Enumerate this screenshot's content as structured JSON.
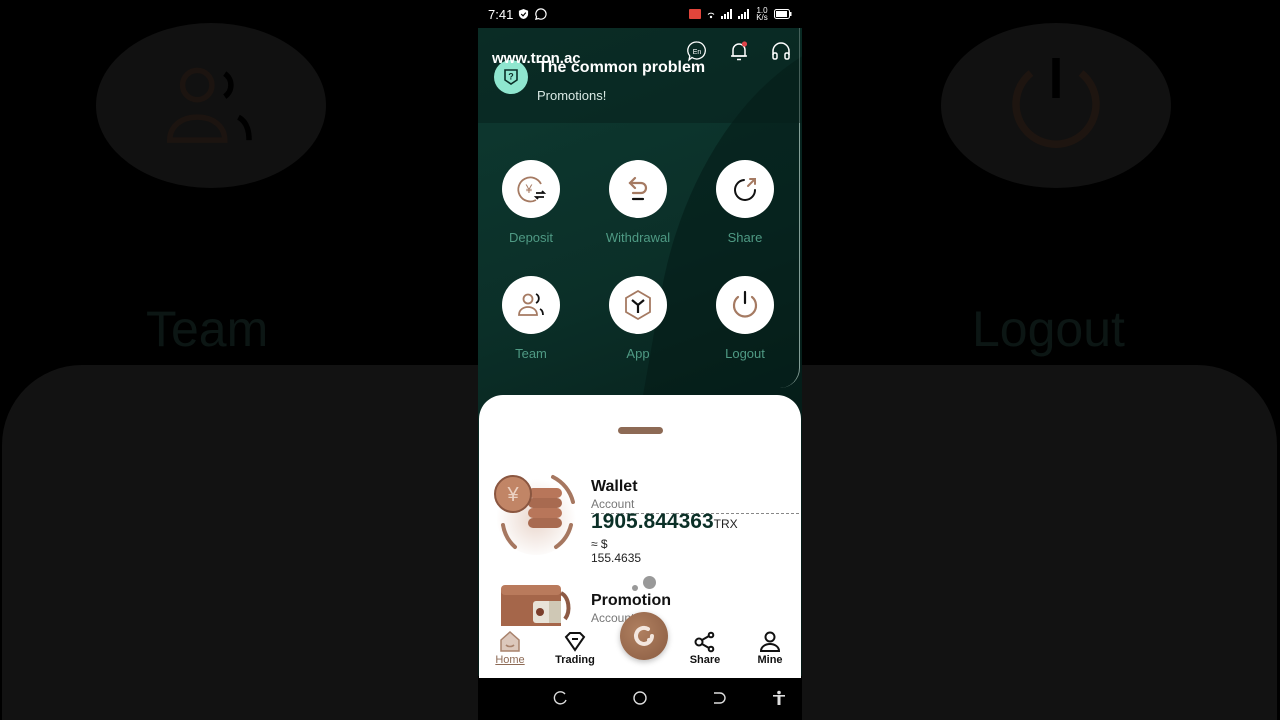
{
  "status_bar": {
    "time": "7:41",
    "left_icons": [
      "shield-check-icon",
      "whatsapp-icon"
    ],
    "right_icons": [
      "cast-icon",
      "wifi-icon",
      "signal-icon",
      "signal-icon"
    ],
    "net_speed": "1.0 K/s",
    "battery_icon": "battery-icon"
  },
  "header": {
    "site_url": "www.tron.ac",
    "icons": [
      "language-icon",
      "bell-icon",
      "headset-icon"
    ],
    "language_label": "En",
    "notification_dot_color": "#e0434a"
  },
  "notice": {
    "title": "The common problem",
    "subtitle": "Promotions!",
    "icon": "question-shield-icon"
  },
  "actions": [
    {
      "label": "Deposit",
      "icon": "deposit-icon"
    },
    {
      "label": "Withdrawal",
      "icon": "withdrawal-icon"
    },
    {
      "label": "Share",
      "icon": "share-icon"
    },
    {
      "label": "Team",
      "icon": "team-icon"
    },
    {
      "label": "App",
      "icon": "app-icon"
    },
    {
      "label": "Logout",
      "icon": "logout-icon"
    }
  ],
  "accounts": [
    {
      "title": "Wallet",
      "subtitle": "Account",
      "amount": "1905.844363",
      "unit": "TRX",
      "usd": "≈ $ 155.4635",
      "icon": "coins-icon"
    },
    {
      "title": "Promotion",
      "subtitle": "Account",
      "icon": "wallet-icon"
    }
  ],
  "bottom_nav": [
    {
      "label": "Home",
      "icon": "home-icon",
      "active": true
    },
    {
      "label": "Trading",
      "icon": "diamond-icon",
      "active": false
    },
    {
      "label": "",
      "icon": "center-action-icon",
      "active": false
    },
    {
      "label": "Share",
      "icon": "share-nodes-icon",
      "active": false
    },
    {
      "label": "Mine",
      "icon": "user-icon",
      "active": false
    }
  ],
  "system_nav": [
    "recent-apps-icon",
    "home-circle-icon",
    "back-icon",
    "accessibility-icon"
  ],
  "background": {
    "left_label": "Team",
    "right_label": "Logout"
  },
  "colors": {
    "accent_brown": "#8d6a55",
    "label_green": "#4f9a84",
    "amount_green": "#0b3027",
    "app_bg": "#0b2f28"
  }
}
